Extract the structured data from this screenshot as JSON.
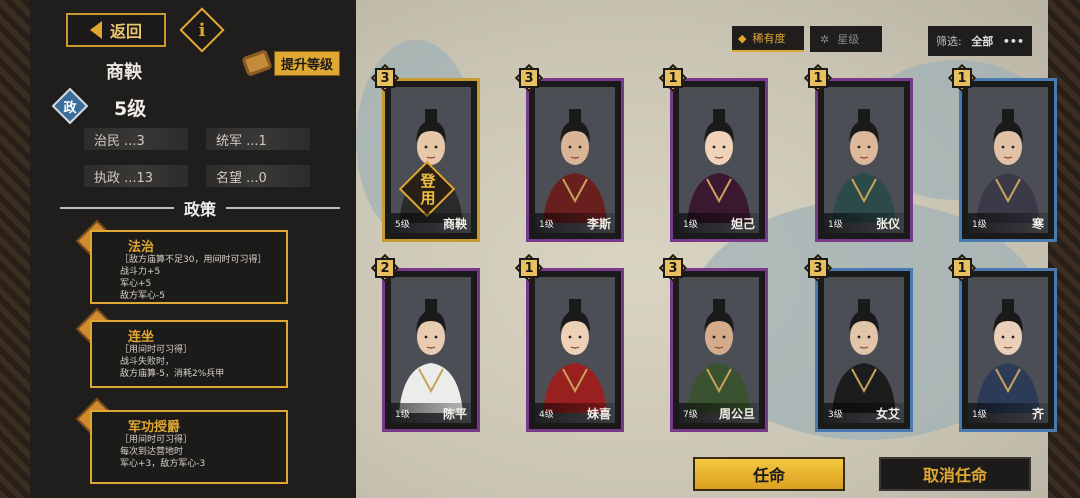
{
  "header": {
    "back_label": "返回",
    "info_icon": "i"
  },
  "leader": {
    "name": "商鞅",
    "upgrade_label": "提升等级",
    "gov_badge": "政",
    "level": "5级",
    "stats": [
      {
        "label": "治民 ...3"
      },
      {
        "label": "统军 ...1"
      },
      {
        "label": "执政 ...13"
      },
      {
        "label": "名望 ...0"
      }
    ]
  },
  "policies_title": "政策",
  "policies": [
    {
      "name": "法治",
      "desc": "［敌方庙算不足30，用间时可习得］\n战斗力+5\n军心+5\n敌方军心-5"
    },
    {
      "name": "连坐",
      "desc": "［用间时可习得］\n战斗失败时，\n敌方庙算-5，消耗2%兵甲"
    },
    {
      "name": "军功授爵",
      "desc": "［用间时可习得］\n每次到达营地时\n军心+3，敌方军心-3"
    }
  ],
  "tabs": {
    "rarity": "稀有度",
    "stars": "星级"
  },
  "filter": {
    "label": "筛选:",
    "value": "全部",
    "more": "•••"
  },
  "cards": [
    {
      "rank": "3",
      "level": "5级",
      "name": "商鞅",
      "border": "#c99a30",
      "appointed": "登\n用"
    },
    {
      "rank": "3",
      "level": "1级",
      "name": "李斯",
      "border": "#7a3a8a"
    },
    {
      "rank": "1",
      "level": "1级",
      "name": "妲己",
      "border": "#7a3a8a"
    },
    {
      "rank": "1",
      "level": "1级",
      "name": "张仪",
      "border": "#7a3a8a"
    },
    {
      "rank": "1",
      "level": "1级",
      "name": "寒",
      "border": "#4a7ab0"
    },
    {
      "rank": "2",
      "level": "1级",
      "name": "陈平",
      "border": "#7a3a8a"
    },
    {
      "rank": "1",
      "level": "4级",
      "name": "妹喜",
      "border": "#7a3a8a"
    },
    {
      "rank": "3",
      "level": "7级",
      "name": "周公旦",
      "border": "#7a3a8a"
    },
    {
      "rank": "3",
      "level": "3级",
      "name": "女艾",
      "border": "#4a7ab0"
    },
    {
      "rank": "1",
      "level": "1级",
      "name": "齐",
      "border": "#4a7ab0"
    }
  ],
  "actions": {
    "appoint": "任命",
    "cancel": "取消任命"
  }
}
